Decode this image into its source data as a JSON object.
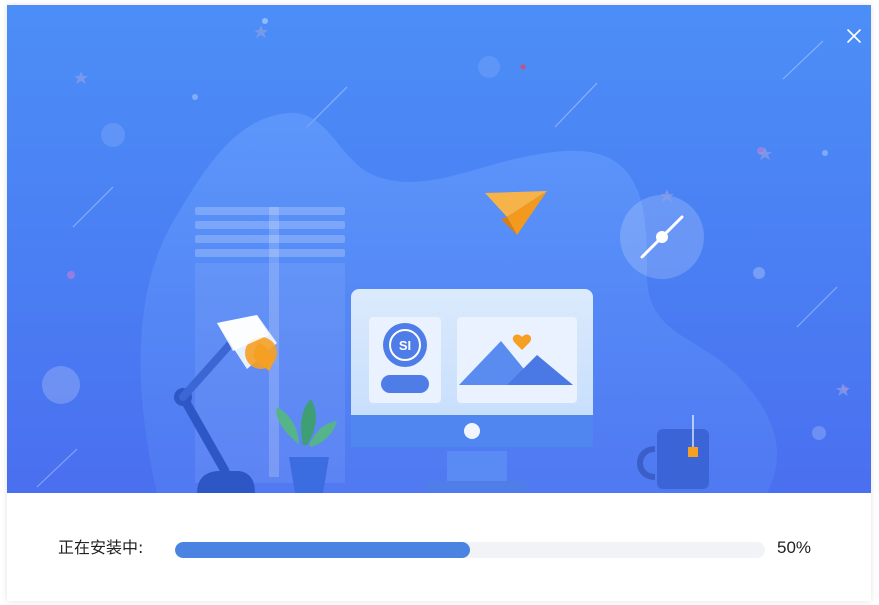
{
  "installer": {
    "status_label": "正在安装中:",
    "progress": 0.5,
    "progress_text": "50%",
    "close_icon": "close-icon"
  },
  "colors": {
    "banner_top": "#4c8ef7",
    "banner_bottom": "#4a6ff0",
    "progress_fill": "#4a83e1",
    "progress_track": "#f1f3f6",
    "accent_orange": "#f5a023"
  },
  "illustration": {
    "logo_text": "SI",
    "icons": [
      "desk-lamp-icon",
      "plant-icon",
      "monitor-icon",
      "paper-plane-icon",
      "clock-icon",
      "mug-icon",
      "document-icon"
    ]
  }
}
